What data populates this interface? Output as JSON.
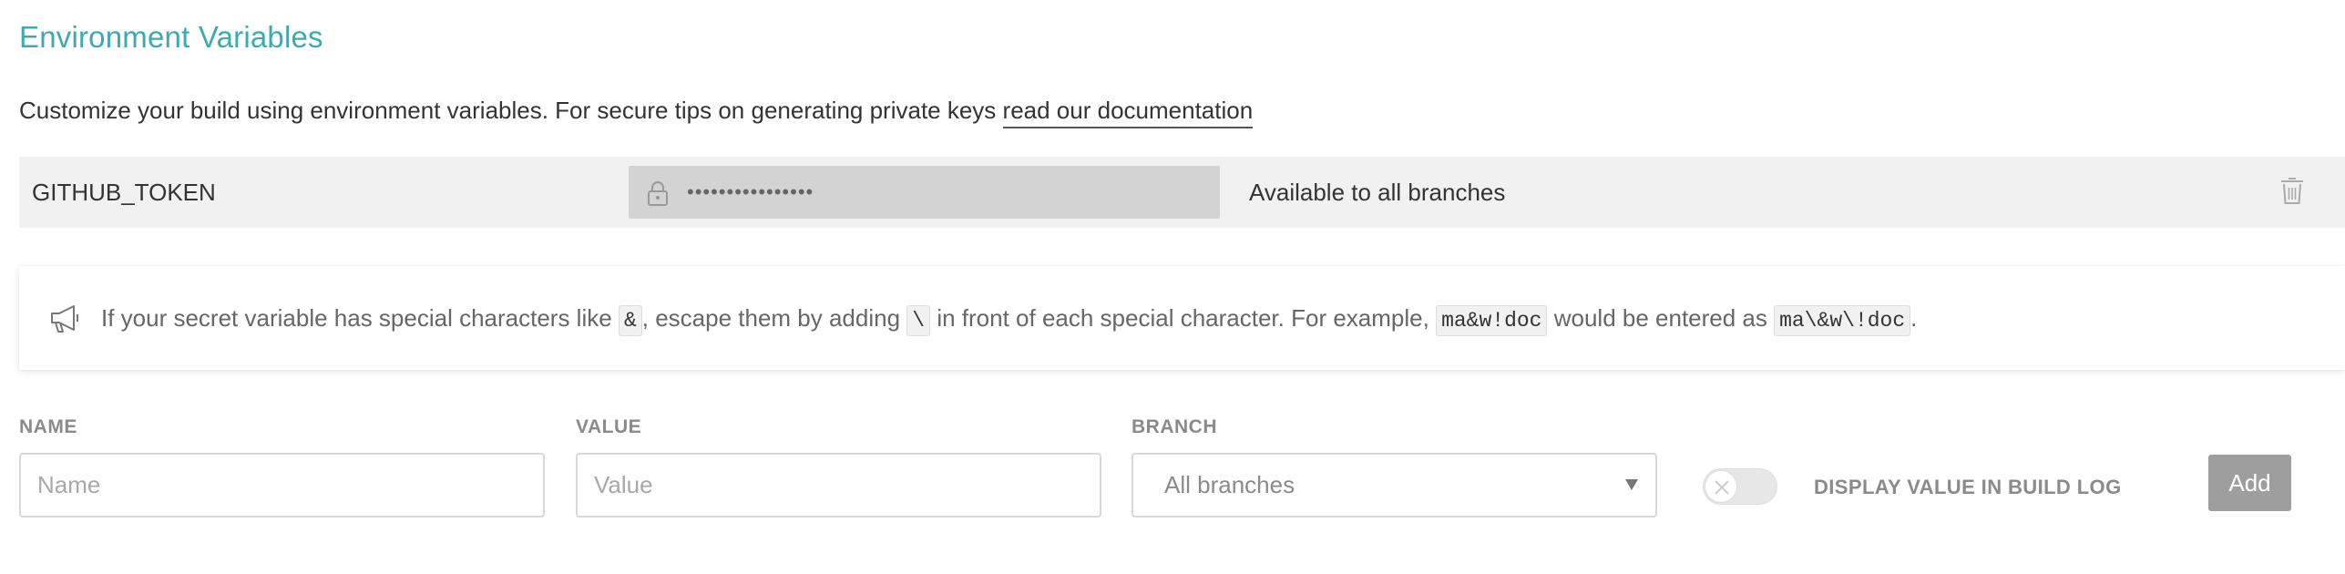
{
  "section": {
    "title": "Environment Variables",
    "description_prefix": "Customize your build using environment variables. For secure tips on generating private keys",
    "description_link": "read our documentation"
  },
  "variables": [
    {
      "name": "GITHUB_TOKEN",
      "masked_value": "••••••••••••••••",
      "branch": "Available to all branches",
      "delete_icon": "trash-icon",
      "lock_icon": "lock-icon"
    }
  ],
  "notice": {
    "icon": "megaphone-icon",
    "part1": "If your secret variable has special characters like",
    "code1": "&",
    "part2": ", escape them by adding",
    "code2": "\\",
    "part3": "in front of each special character. For example,",
    "code3": "ma&w!doc",
    "part4": "would be entered as",
    "code4": "ma\\&w\\!doc",
    "part5": "."
  },
  "form": {
    "name_label": "NAME",
    "name_placeholder": "Name",
    "value_label": "VALUE",
    "value_placeholder": "Value",
    "branch_label": "BRANCH",
    "branch_selected": "All branches",
    "toggle_label": "DISPLAY VALUE IN BUILD LOG",
    "toggle_on": false,
    "add_label": "Add"
  },
  "colors": {
    "accent": "#3eaaaf",
    "row_bg": "#f1f1f1",
    "masked_bg": "#d3d3d3",
    "button_bg": "#9e9e9e"
  }
}
